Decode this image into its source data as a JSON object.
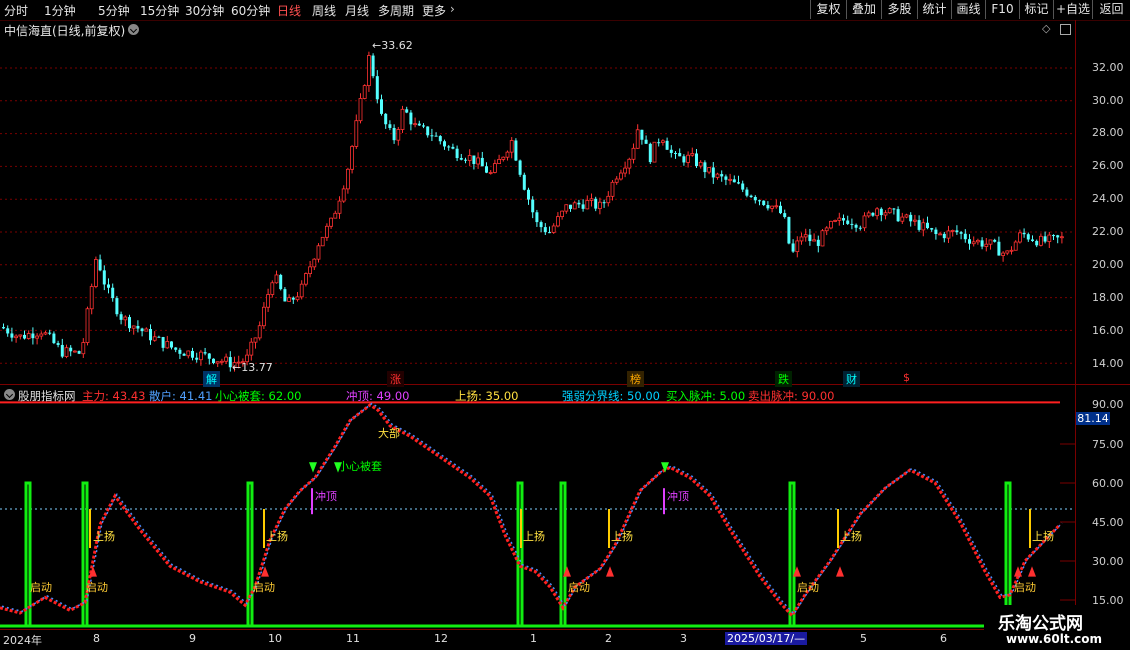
{
  "toolbar": {
    "periods": [
      "分时",
      "1分钟",
      "5分钟",
      "15分钟",
      "30分钟",
      "60分钟",
      "日线",
      "周线",
      "月线",
      "多周期",
      "更多"
    ],
    "active_period": "日线",
    "more_icon": "chevron-right-icon",
    "right_buttons": [
      "复权",
      "叠加",
      "多股",
      "统计",
      "画线",
      "F10",
      "标记",
      "+自选",
      "返回"
    ]
  },
  "main_chart": {
    "title": "中信海直(日线,前复权)",
    "high_label": "33.62",
    "low_label": "13.77",
    "y_ticks": [
      "32.00",
      "30.00",
      "28.00",
      "26.00",
      "24.00",
      "22.00",
      "20.00",
      "18.00",
      "16.00",
      "14.00"
    ],
    "signal_tags": [
      {
        "text": "解",
        "color": "#00ffff"
      },
      {
        "text": "涨",
        "color": "#ff3030"
      },
      {
        "text": "榜",
        "color": "#ffaa00"
      },
      {
        "text": "跌",
        "color": "#00ff00"
      },
      {
        "text": "财",
        "color": "#00ffff"
      },
      {
        "text": "$",
        "color": "#ff3030"
      }
    ],
    "colors": {
      "up": "#ff3232",
      "down": "#54ffff",
      "grid": "#7a0000"
    }
  },
  "indicator": {
    "name": "股朋指标网",
    "fields": [
      {
        "label": "主力:",
        "value": "43.43",
        "color": "#ff3030"
      },
      {
        "label": "散户:",
        "value": "41.41",
        "color": "#50a0ff"
      },
      {
        "label": "小心被套:",
        "value": "62.00",
        "color": "#00ff00"
      },
      {
        "label": "冲顶:",
        "value": "49.00",
        "color": "#e040ff"
      },
      {
        "label": "上扬:",
        "value": "35.00",
        "color": "#ffe040"
      },
      {
        "label": "强弱分界线:",
        "value": "50.00",
        "color": "#00d0ff"
      },
      {
        "label": "买入脉冲:",
        "value": "5.00",
        "color": "#00ff00"
      },
      {
        "label": "卖出脉冲:",
        "value": "90.00",
        "color": "#ff3030"
      }
    ],
    "current_value": "81.14",
    "y_ticks": [
      "90.00",
      "75.00",
      "60.00",
      "45.00",
      "30.00",
      "15.00"
    ],
    "annotations": {
      "start": "启动",
      "rise": "上扬",
      "top": "冲顶",
      "careful": "小心被套",
      "big_top": "大部"
    }
  },
  "x_axis": {
    "labels": [
      "2024年",
      "8",
      "9",
      "10",
      "11",
      "12",
      "1",
      "2",
      "3",
      "2025/03/17/—",
      "5",
      "6"
    ]
  },
  "watermark": {
    "cn": "乐淘公式网",
    "url": "www.60lt.com"
  }
}
